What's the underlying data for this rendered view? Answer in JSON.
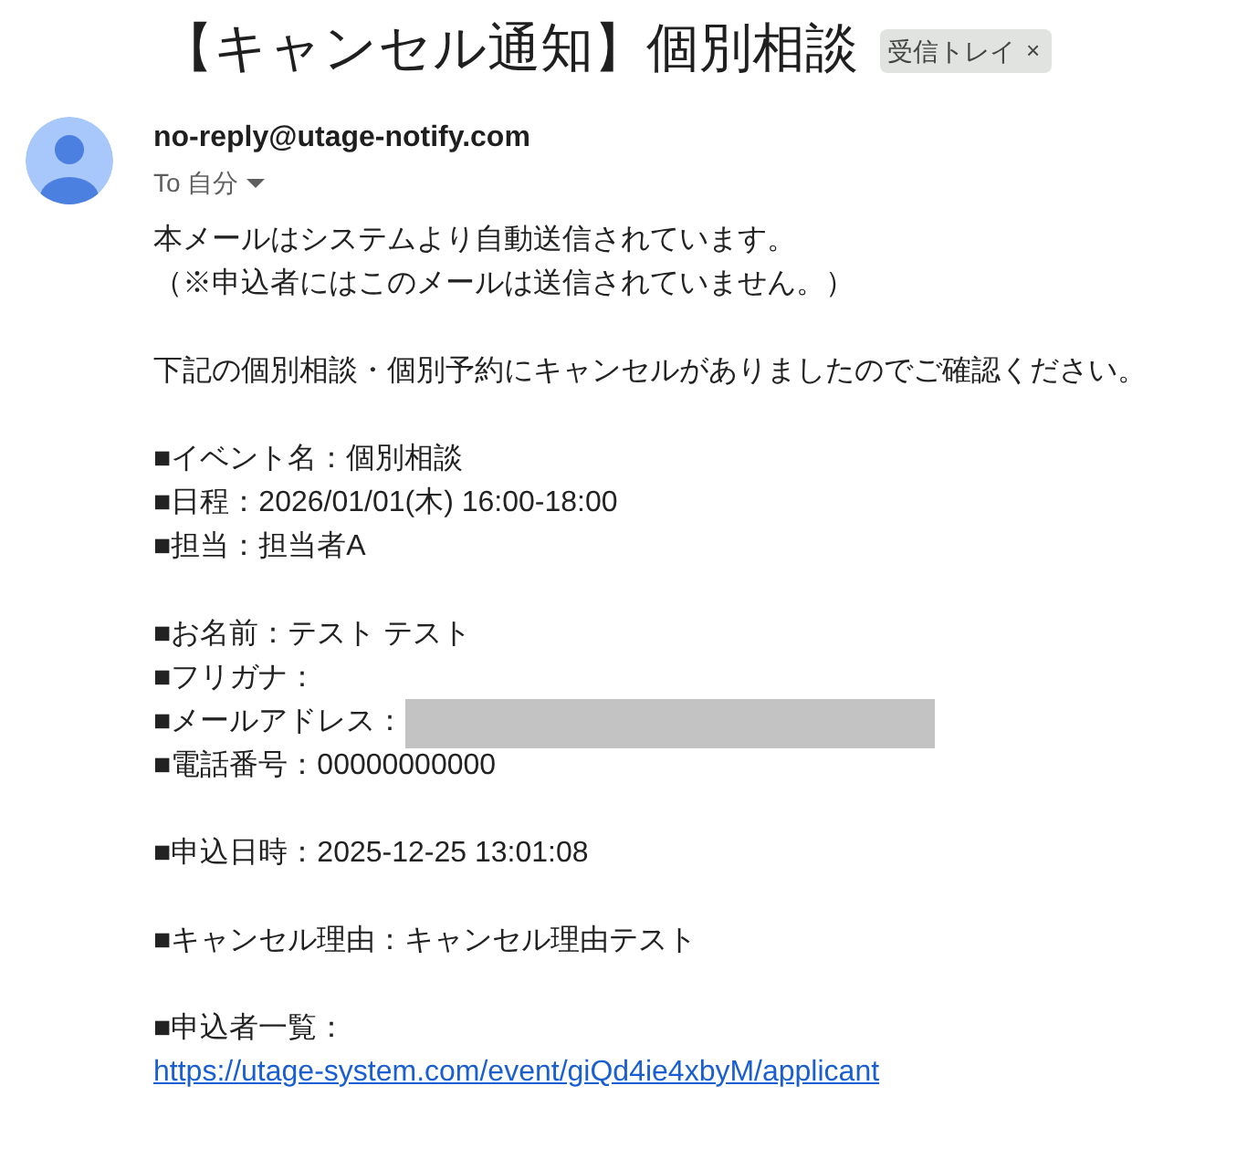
{
  "subject": {
    "title": "【キャンセル通知】個別相談",
    "label": "受信トレイ",
    "label_close": "×"
  },
  "sender": {
    "address": "no-reply@utage-notify.com",
    "to": "To 自分"
  },
  "body": [
    {
      "kind": "text",
      "text": "本メールはシステムより自動送信されています。"
    },
    {
      "kind": "text",
      "text": "（※申込者にはこのメールは送信されていません。）"
    },
    {
      "kind": "blank"
    },
    {
      "kind": "text",
      "text": "下記の個別相談・個別予約にキャンセルがありましたのでご確認ください。"
    },
    {
      "kind": "blank"
    },
    {
      "kind": "text",
      "text": "■イベント名：個別相談"
    },
    {
      "kind": "text",
      "text": "■日程：2026/01/01(木) 16:00-18:00"
    },
    {
      "kind": "text",
      "text": "■担当：担当者A"
    },
    {
      "kind": "blank"
    },
    {
      "kind": "text",
      "text": "■お名前：テスト テスト"
    },
    {
      "kind": "text",
      "text": "■フリガナ："
    },
    {
      "kind": "redacted",
      "text": "■メールアドレス："
    },
    {
      "kind": "text",
      "text": "■電話番号：00000000000"
    },
    {
      "kind": "blank"
    },
    {
      "kind": "text",
      "text": "■申込日時：2025-12-25 13:01:08"
    },
    {
      "kind": "blank"
    },
    {
      "kind": "text",
      "text": "■キャンセル理由：キャンセル理由テスト"
    },
    {
      "kind": "blank"
    },
    {
      "kind": "text",
      "text": "■申込者一覧："
    },
    {
      "kind": "link",
      "text": "https://utage-system.com/event/giQd4ie4xbyM/applicant"
    }
  ]
}
